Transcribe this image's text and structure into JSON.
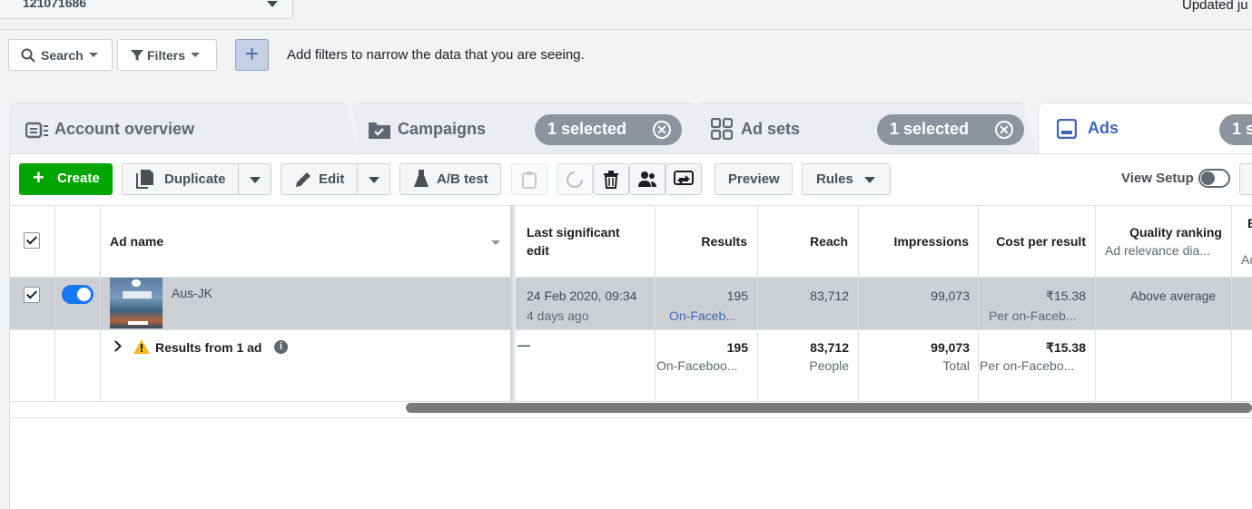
{
  "account": {
    "id": "121071686",
    "updated_text": "Updated ju"
  },
  "filter_bar": {
    "search_label": "Search",
    "filters_label": "Filters",
    "add_label": "+",
    "hint": "Add filters to narrow the data that you are seeing."
  },
  "tabs": [
    {
      "label": "Account overview"
    },
    {
      "label": "Campaigns",
      "pill": "1 selected"
    },
    {
      "label": "Ad sets",
      "pill": "1 selected"
    },
    {
      "label": "Ads",
      "pill": "1 s"
    }
  ],
  "toolbar": {
    "create_label": "Create",
    "duplicate_label": "Duplicate",
    "edit_label": "Edit",
    "ab_test_label": "A/B test",
    "preview_label": "Preview",
    "rules_label": "Rules",
    "view_setup_label": "View Setup"
  },
  "table": {
    "headers": {
      "ad_name": "Ad name",
      "last_edit_1": "Last significant",
      "last_edit_2": "edit",
      "results": "Results",
      "reach": "Reach",
      "impressions": "Impressions",
      "cost_per_result": "Cost per result",
      "quality_ranking": "Quality ranking",
      "quality_sub": "Ad relevance dia...",
      "cut_col": "E",
      "cut_col_sub": "Ac"
    },
    "row": {
      "ad_name": "Aus-JK",
      "last_edit_date": "24 Feb 2020, 09:34",
      "last_edit_ago": "4 days ago",
      "results": "195",
      "results_sub": "On-Faceb...",
      "reach": "83,712",
      "impressions": "99,073",
      "cost": "₹15.38",
      "cost_sub": "Per on-Faceb...",
      "quality": "Above average"
    },
    "summary": {
      "label": "Results from 1 ad",
      "last_edit": "—",
      "results": "195",
      "results_sub": "On-Faceboo...",
      "reach": "83,712",
      "reach_sub": "People",
      "impressions": "99,073",
      "impressions_sub": "Total",
      "cost": "₹15.38",
      "cost_sub": "Per on-Facebo..."
    }
  },
  "colors": {
    "brand_blue": "#4267b2",
    "create_green": "#00a400",
    "toggle_blue": "#1877f2",
    "warning": "#f7b928"
  }
}
